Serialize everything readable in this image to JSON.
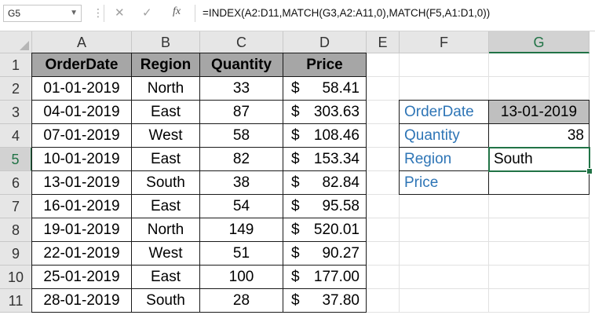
{
  "formula_bar": {
    "name_box": "G5",
    "fx": "fx",
    "formula": "=INDEX(A2:D11,MATCH(G3,A2:A11,0),MATCH(F5,A1:D1,0))"
  },
  "selected_cell": "G5",
  "columns": [
    "A",
    "B",
    "C",
    "D",
    "E",
    "F",
    "G"
  ],
  "rows": [
    "1",
    "2",
    "3",
    "4",
    "5",
    "6",
    "7",
    "8",
    "9",
    "10",
    "11"
  ],
  "table": {
    "headers": [
      "OrderDate",
      "Region",
      "Quantity",
      "Price"
    ],
    "rows": [
      [
        "01-01-2019",
        "North",
        "33",
        "$",
        "58.41"
      ],
      [
        "04-01-2019",
        "East",
        "87",
        "$",
        "303.63"
      ],
      [
        "07-01-2019",
        "West",
        "58",
        "$",
        "108.46"
      ],
      [
        "10-01-2019",
        "East",
        "82",
        "$",
        "153.34"
      ],
      [
        "13-01-2019",
        "South",
        "38",
        "$",
        "82.84"
      ],
      [
        "16-01-2019",
        "East",
        "54",
        "$",
        "95.58"
      ],
      [
        "19-01-2019",
        "North",
        "149",
        "$",
        "520.01"
      ],
      [
        "22-01-2019",
        "West",
        "51",
        "$",
        "90.27"
      ],
      [
        "25-01-2019",
        "East",
        "100",
        "$",
        "177.00"
      ],
      [
        "28-01-2019",
        "South",
        "28",
        "$",
        "37.80"
      ]
    ]
  },
  "lookup": {
    "orderdate_label": "OrderDate",
    "orderdate_value": "13-01-2019",
    "quantity_label": "Quantity",
    "quantity_value": "38",
    "region_label": "Region",
    "region_value": "South",
    "price_label": "Price",
    "price_value": ""
  },
  "colors": {
    "accent": "#217346",
    "label_blue": "#2e75b6",
    "header_fill": "#a6a6a6",
    "lookup_fill": "#bfbfbf"
  }
}
